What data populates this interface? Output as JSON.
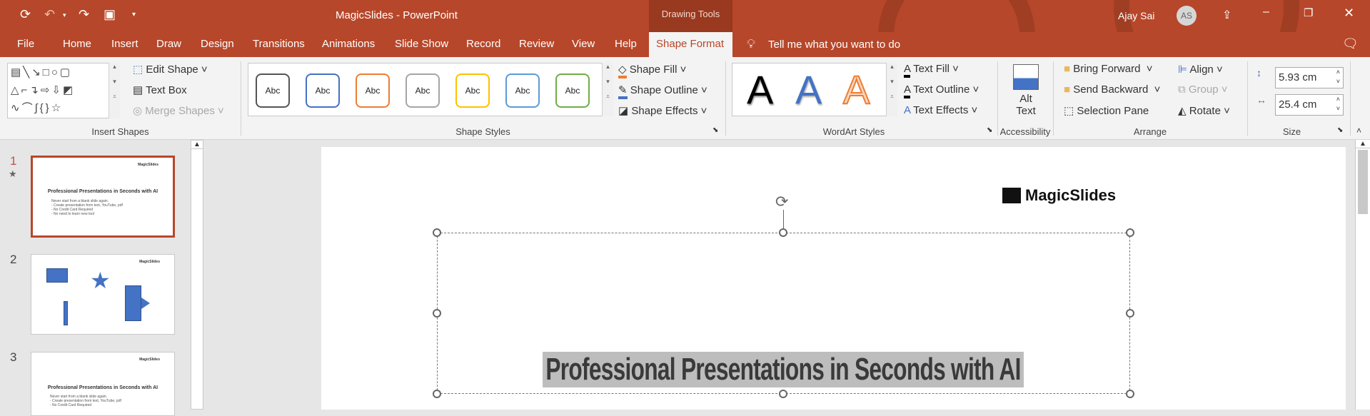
{
  "titlebar": {
    "title": "MagicSlides  -  PowerPoint",
    "context_tab": "Drawing Tools",
    "user_name": "Ajay Sai",
    "user_initials": "AS"
  },
  "tabs": [
    "File",
    "Home",
    "Insert",
    "Draw",
    "Design",
    "Transitions",
    "Animations",
    "Slide Show",
    "Record",
    "Review",
    "View",
    "Help",
    "Shape Format"
  ],
  "tell_me": "Tell me what you want to do",
  "ribbon": {
    "insert_shapes": {
      "label": "Insert Shapes",
      "edit_shape": "Edit Shape",
      "text_box": "Text Box",
      "merge_shapes": "Merge Shapes"
    },
    "shape_styles": {
      "label": "Shape Styles",
      "sample": "Abc",
      "style_colors": [
        "#555555",
        "#4472c4",
        "#ed7d31",
        "#a5a5a5",
        "#ffc000",
        "#5b9bd5",
        "#70ad47"
      ],
      "shape_fill": "Shape Fill",
      "shape_outline": "Shape Outline",
      "shape_effects": "Shape Effects"
    },
    "wordart": {
      "label": "WordArt Styles",
      "sample": "A",
      "text_fill": "Text Fill",
      "text_outline": "Text Outline",
      "text_effects": "Text Effects"
    },
    "accessibility": {
      "label": "Accessibility",
      "alt_text_1": "Alt",
      "alt_text_2": "Text"
    },
    "arrange": {
      "label": "Arrange",
      "bring_forward": "Bring Forward",
      "send_backward": "Send Backward",
      "selection_pane": "Selection Pane",
      "align": "Align",
      "group": "Group",
      "rotate": "Rotate"
    },
    "size": {
      "label": "Size",
      "height": "5.93 cm",
      "width": "25.4 cm"
    }
  },
  "slides": [
    {
      "number": "1",
      "title": "Professional Presentations in Seconds with AI",
      "body": [
        "Never start from a blank slide again.",
        "- Create presentation from text, YouTube, pdf",
        "- No Credit Card Required",
        "- No need to learn new tool"
      ],
      "logo": "MagicSlides"
    },
    {
      "number": "2",
      "logo": "MagicSlides"
    },
    {
      "number": "3",
      "title": "Professional Presentations in Seconds with AI",
      "body": [
        "Never start from a blank slide again.",
        "- Create presentation from text, YouTube, pdf",
        "- No Credit Card Required"
      ],
      "logo": "MagicSlides"
    }
  ],
  "canvas": {
    "logo": "MagicSlides",
    "title": "Professional Presentations in Seconds with AI"
  },
  "colors": {
    "accent": "#b7472a",
    "context": "#99391f",
    "shape_blue": "#4472c4"
  }
}
